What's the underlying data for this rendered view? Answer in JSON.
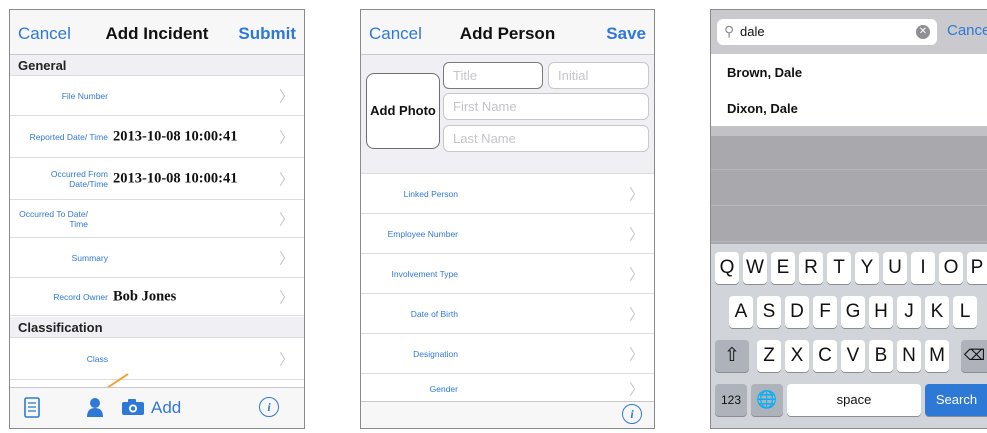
{
  "incident": {
    "nav": {
      "cancel": "Cancel",
      "title": "Add Incident",
      "submit": "Submit"
    },
    "sections": {
      "general": "General",
      "classification": "Classification"
    },
    "rows": [
      {
        "label": "File Number",
        "value": ""
      },
      {
        "label": "Reported Date/ Time",
        "value": "2013-10-08 10:00:41"
      },
      {
        "label": "Occurred From Date/Time",
        "value": "2013-10-08 10:00:41"
      },
      {
        "label": "Occurred To Date/ Time",
        "value": ""
      },
      {
        "label": "Summary",
        "value": ""
      },
      {
        "label": "Record Owner",
        "value": "Bob Jones"
      },
      {
        "label": "Class",
        "value": ""
      }
    ],
    "toolbar": {
      "add": "Add",
      "icons": [
        "document-icon",
        "person-icon",
        "camera-icon",
        "info-icon"
      ]
    },
    "arrow_color": "#f2a43a"
  },
  "person": {
    "nav": {
      "cancel": "Cancel",
      "title": "Add Person",
      "save": "Save"
    },
    "add_photo": "Add Photo",
    "placeholders": {
      "title": "Title",
      "initial": "Initial",
      "first_name": "First Name",
      "last_name": "Last Name"
    },
    "rows": [
      "Linked Person",
      "Employee Number",
      "Involvement Type",
      "Date of Birth",
      "Designation",
      "Gender"
    ]
  },
  "search": {
    "query": "dale",
    "cancel": "Cancel",
    "results": [
      "Brown, Dale",
      "Dixon, Dale"
    ],
    "keyboard": {
      "row1": [
        "Q",
        "W",
        "E",
        "R",
        "T",
        "Y",
        "U",
        "I",
        "O",
        "P"
      ],
      "row2": [
        "A",
        "S",
        "D",
        "F",
        "G",
        "H",
        "J",
        "K",
        "L"
      ],
      "row3": [
        "Z",
        "X",
        "C",
        "V",
        "B",
        "N",
        "M"
      ],
      "numbers": "123",
      "space": "space",
      "search": "Search"
    }
  },
  "colors": {
    "accent": "#2f79d6",
    "search_key": "#2f79d6"
  }
}
